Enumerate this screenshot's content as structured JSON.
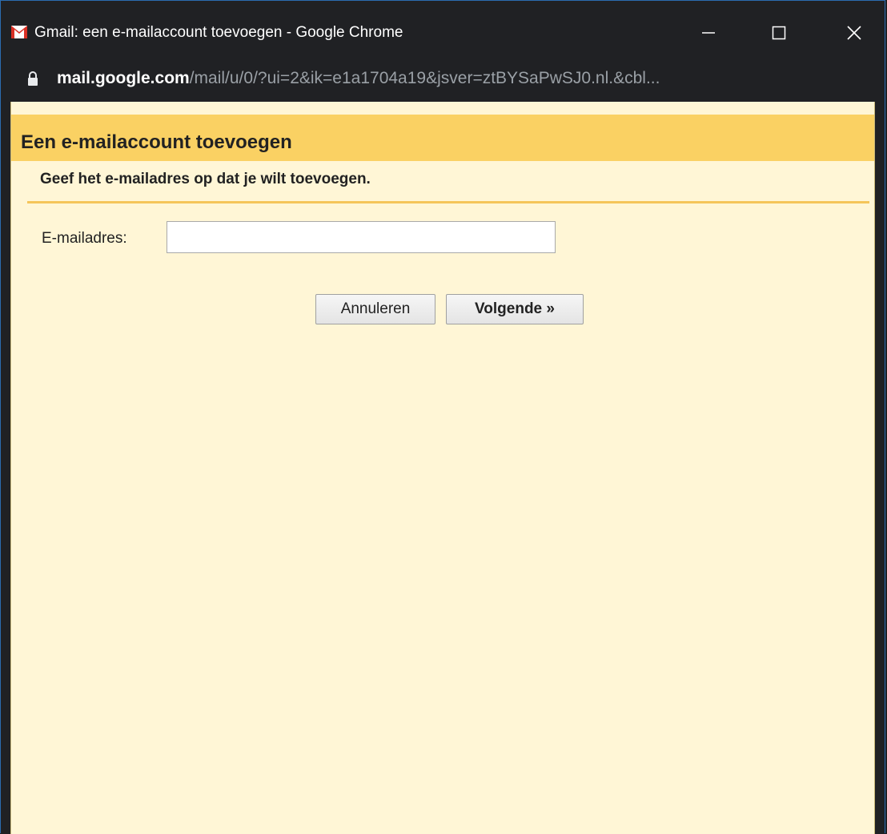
{
  "window": {
    "title": "Gmail: een e-mailaccount toevoegen - Google Chrome",
    "app_icon": "gmail-icon",
    "controls": {
      "minimize_icon": "minimize-icon",
      "maximize_icon": "maximize-icon",
      "close_icon": "close-icon"
    }
  },
  "address_bar": {
    "lock_icon": "lock-icon",
    "url_host": "mail.google.com",
    "url_path": "/mail/u/0/?ui=2&ik=e1a1704a19&jsver=ztBYSaPwSJ0.nl.&cbl..."
  },
  "dialog": {
    "title": "Een e-mailaccount toevoegen",
    "instruction": "Geef het e-mailadres op dat je wilt toevoegen.",
    "email_label": "E-mailadres:",
    "email_value": "",
    "cancel_label": "Annuleren",
    "next_label": "Volgende »"
  },
  "colors": {
    "header_bg": "#fad163",
    "content_bg": "#fff6d6",
    "divider": "#f5c55a",
    "titlebar_bg": "#202124",
    "gmail_red": "#d93025"
  }
}
